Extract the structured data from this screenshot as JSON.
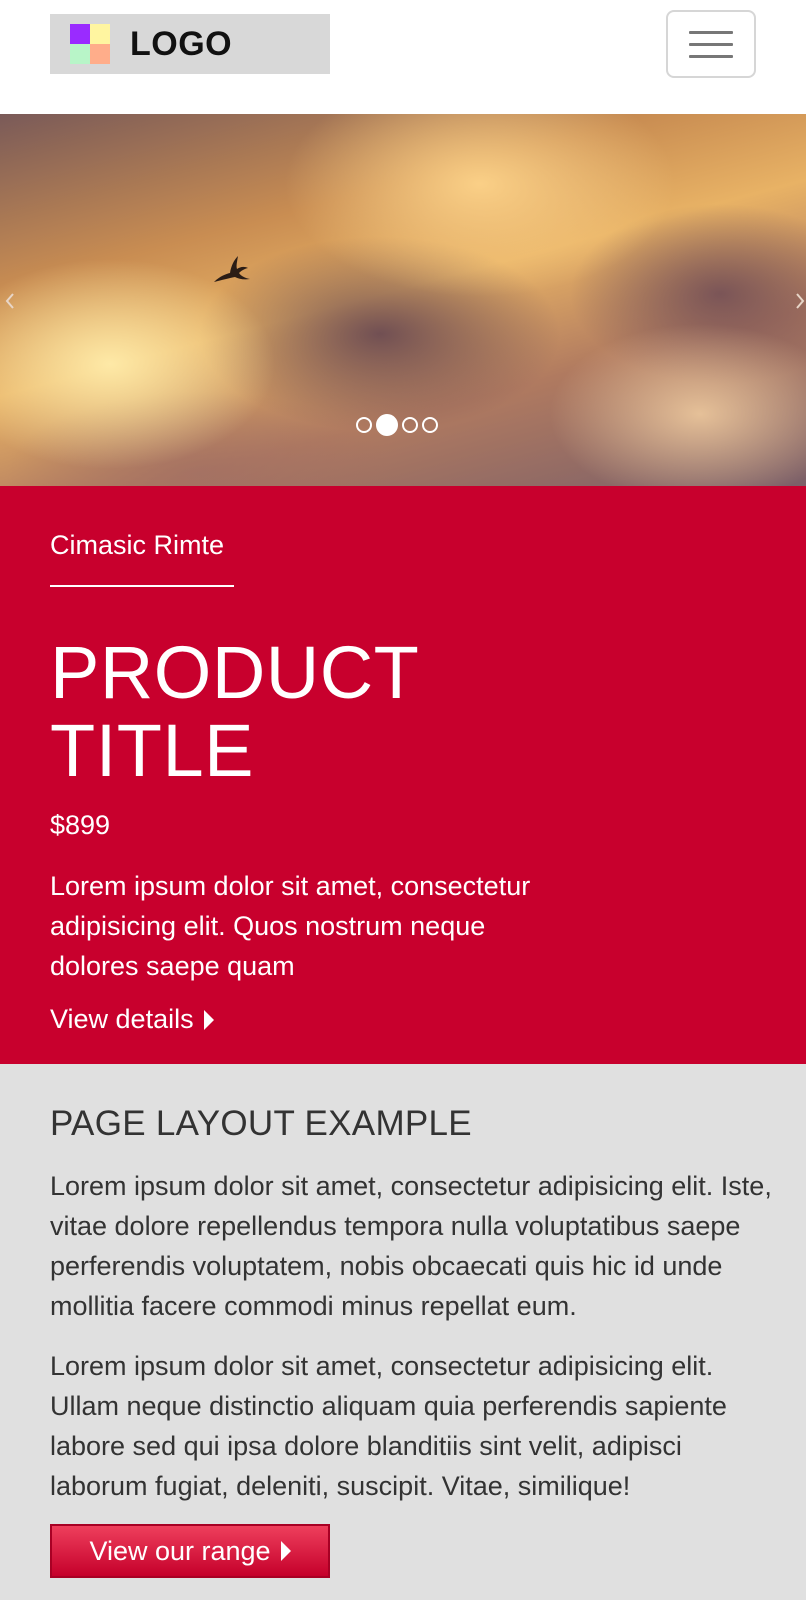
{
  "header": {
    "logo_text": "LOGO",
    "logo_colors": [
      "#9a2bff",
      "#fff5a0",
      "#b8f5c8",
      "#ffad8a"
    ],
    "menu_icon": "hamburger-icon"
  },
  "carousel": {
    "slide_count": 4,
    "active_slide": 2,
    "prev_icon": "chevron-left-icon",
    "next_icon": "chevron-right-icon"
  },
  "product": {
    "category": "Cimasic Rimte",
    "title": "PRODUCT TITLE",
    "price": "$899",
    "description": "Lorem ipsum dolor sit amet, consectetur adipisicing elit. Quos nostrum neque dolores saepe quam",
    "details_link": "View details",
    "accent_color": "#c8002d"
  },
  "section": {
    "heading": "PAGE LAYOUT EXAMPLE",
    "paragraphs": [
      "Lorem ipsum dolor sit amet, consectetur adipisicing elit. Iste, vitae dolore repellendus tempora nulla voluptatibus saepe perferendis voluptatem, nobis obcaecati quis hic id unde mollitia facere commodi minus repellat eum.",
      "Lorem ipsum dolor sit amet, consectetur adipisicing elit. Ullam neque distinctio aliquam quia perferendis sapiente labore sed qui ipsa dolore blanditiis sint velit, adipisci laborum fugiat, deleniti, suscipit. Vitae, similique!"
    ],
    "cta_label": "View our range"
  }
}
